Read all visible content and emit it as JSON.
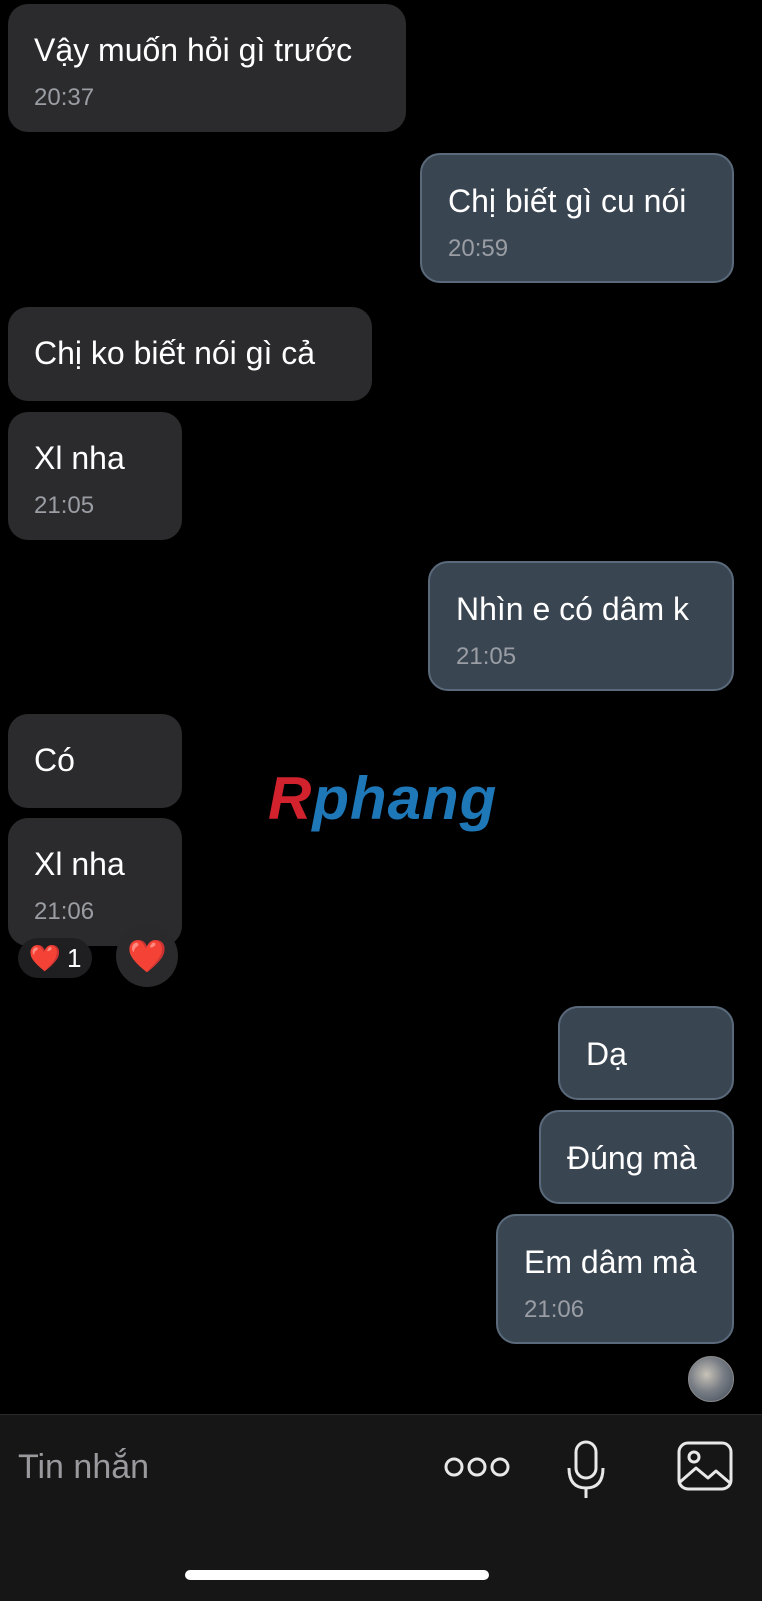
{
  "messages": [
    {
      "dir": "in",
      "text": "Vậy muốn hỏi gì trước",
      "time": "20:37"
    },
    {
      "dir": "out",
      "text": "Chị biết gì cu nói",
      "time": "20:59"
    },
    {
      "dir": "in",
      "text": "Chị ko biết nói gì cả"
    },
    {
      "dir": "in",
      "text": "Xl nha",
      "time": "21:05"
    },
    {
      "dir": "out",
      "text": "Nhìn e có dâm k",
      "time": "21:05"
    },
    {
      "dir": "in",
      "text": "Có"
    },
    {
      "dir": "in",
      "text": "Xl nha",
      "time": "21:06"
    },
    {
      "dir": "out",
      "text": "Dạ"
    },
    {
      "dir": "out",
      "text": "Đúng mà"
    },
    {
      "dir": "out",
      "text": "Em dâm mà",
      "time": "21:06"
    }
  ],
  "reaction": {
    "emoji": "❤️",
    "count": "1",
    "quick_emoji": "❤️"
  },
  "watermark": {
    "part1": "R",
    "part2": "phang"
  },
  "composer": {
    "placeholder": "Tin nhắn"
  },
  "icons": {
    "more": "more-dots-icon",
    "mic": "microphone-icon",
    "gallery": "image-gallery-icon"
  },
  "colors": {
    "incoming": "#2b2b2d",
    "outgoing": "#3a4552",
    "background": "#000000"
  }
}
